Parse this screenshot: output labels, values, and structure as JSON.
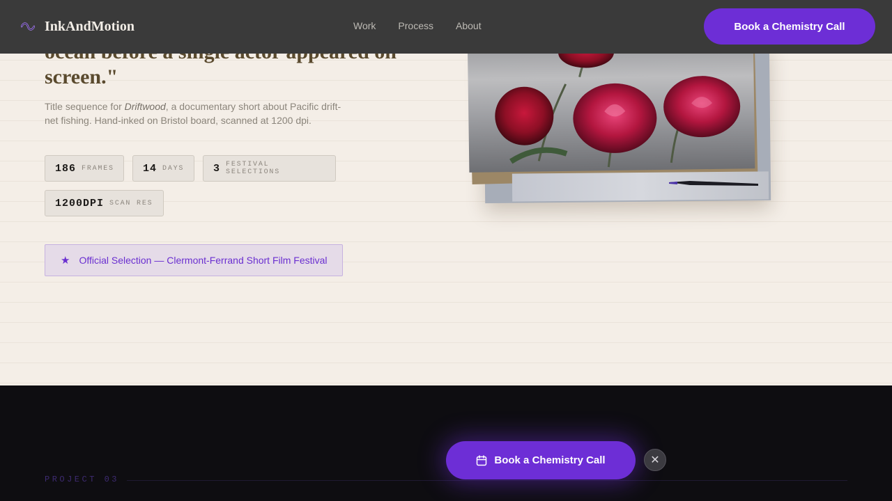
{
  "nav": {
    "logo_text": "InkAndMotion",
    "logo_icon": "infinity-wave-icon",
    "links": [
      "Work",
      "Process",
      "About"
    ],
    "cta_label": "Book a Chemistry Call"
  },
  "hero": {
    "quote": "ocean before a single actor appeared on screen.\"",
    "desc_prefix": "Title sequence for ",
    "desc_film": "Driftwood",
    "desc_suffix": ", a documentary short about Pacific drift-net fishing. Hand-inked on Bristol board, scanned at 1200 dpi.",
    "stats": [
      {
        "value": "186",
        "label": "FRAMES"
      },
      {
        "value": "14",
        "label": "DAYS"
      },
      {
        "value": "3",
        "label": "FESTIVAL SELECTIONS"
      },
      {
        "value": "1200DPI",
        "label": "SCAN RES"
      }
    ],
    "award": "Official Selection — Clermont-Ferrand Short Film Festival",
    "award_icon": "star-icon"
  },
  "next_section": {
    "label": "PROJECT 03"
  },
  "floating_cta": {
    "label": "Book a Chemistry Call",
    "icon": "calendar-icon",
    "close_icon": "close-icon"
  },
  "colors": {
    "accent": "#6d2ed6",
    "paper": "#f4eee7",
    "nav_bg": "#3a3a3a",
    "dark_bg": "#0e0d11"
  }
}
